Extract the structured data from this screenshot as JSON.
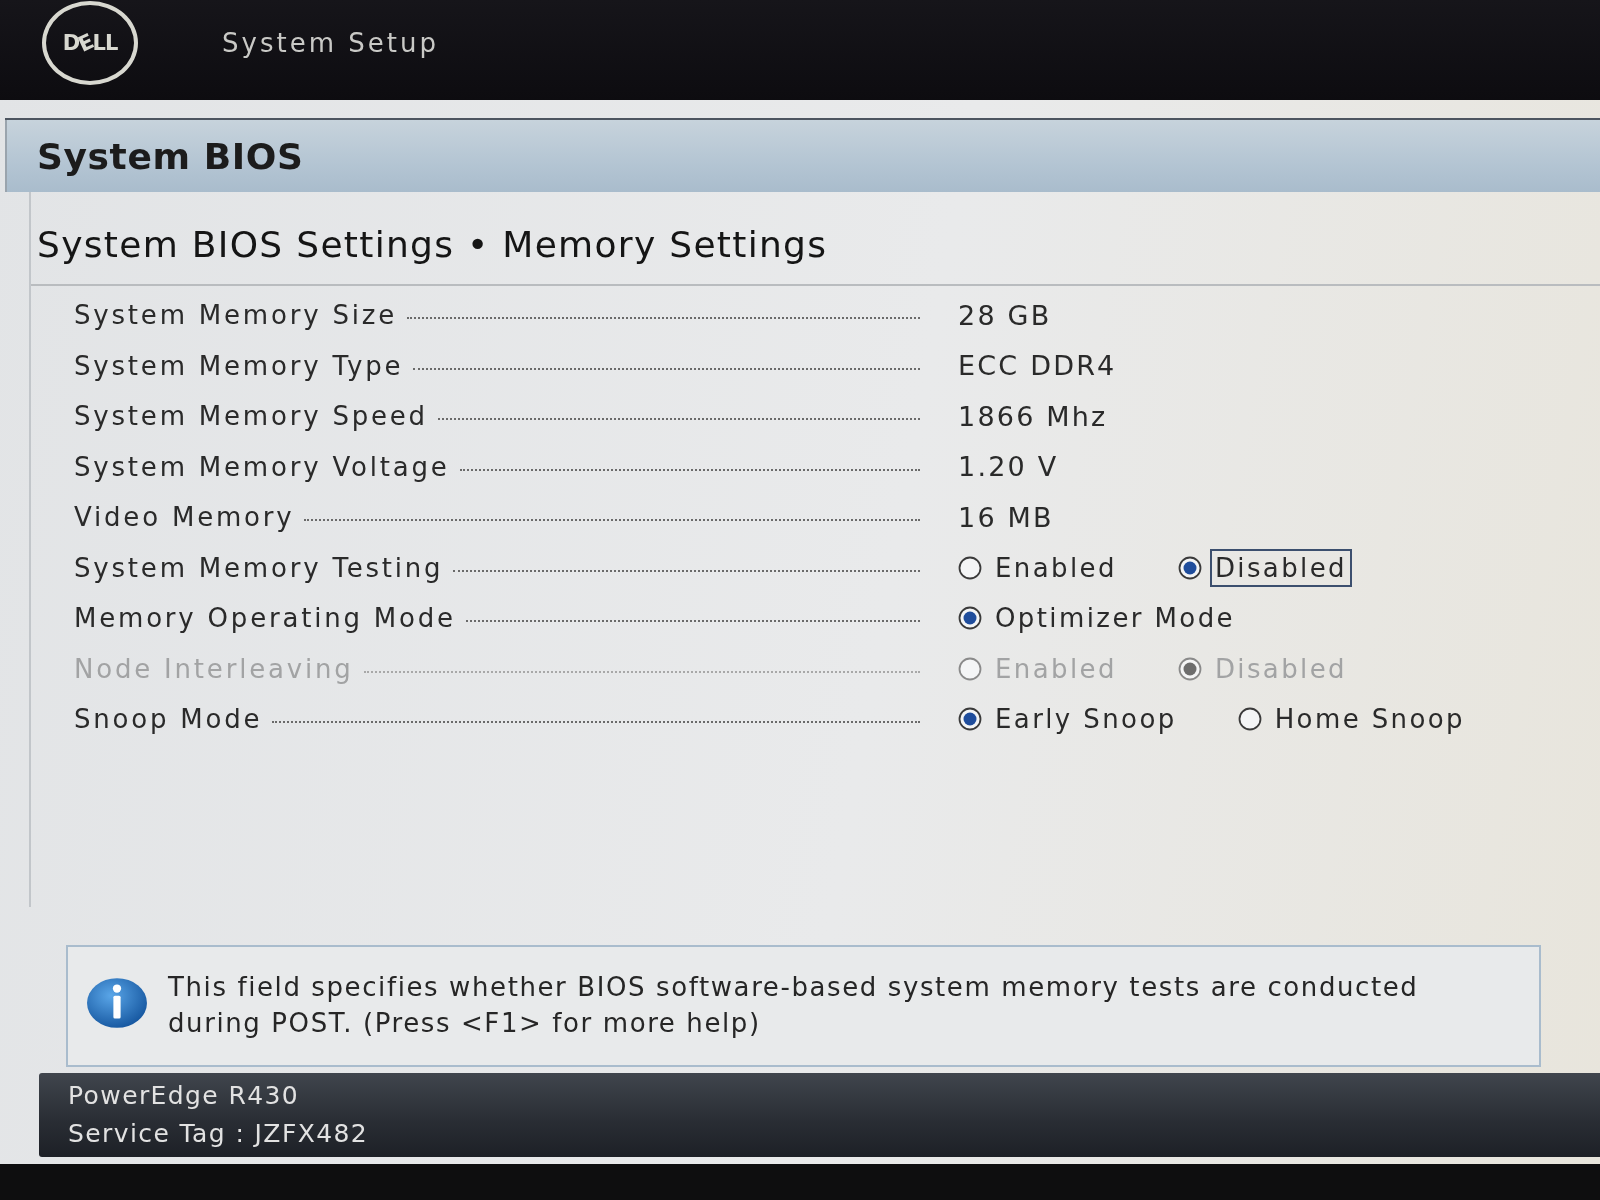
{
  "header": {
    "logo": "DELL",
    "title": "System Setup"
  },
  "page": {
    "title": "System BIOS",
    "subtitle": "System BIOS Settings • Memory Settings"
  },
  "settings": [
    {
      "kind": "text",
      "label": "System Memory Size",
      "value": "28 GB",
      "disabled": false
    },
    {
      "kind": "text",
      "label": "System Memory Type",
      "value": "ECC DDR4",
      "disabled": false
    },
    {
      "kind": "text",
      "label": "System Memory Speed",
      "value": "1866 Mhz",
      "disabled": false
    },
    {
      "kind": "text",
      "label": "System Memory Voltage",
      "value": "1.20 V",
      "disabled": false
    },
    {
      "kind": "text",
      "label": "Video Memory",
      "value": "16 MB",
      "disabled": false
    },
    {
      "kind": "radio",
      "label": "System Memory Testing",
      "disabled": false,
      "options": [
        {
          "label": "Enabled",
          "selected": false,
          "focused": false
        },
        {
          "label": "Disabled",
          "selected": true,
          "focused": true
        }
      ]
    },
    {
      "kind": "radio",
      "label": "Memory Operating Mode",
      "disabled": false,
      "options": [
        {
          "label": "Optimizer Mode",
          "selected": true,
          "focused": false
        }
      ]
    },
    {
      "kind": "radio",
      "label": "Node Interleaving",
      "disabled": true,
      "options": [
        {
          "label": "Enabled",
          "selected": false,
          "focused": false
        },
        {
          "label": "Disabled",
          "selected": true,
          "focused": false
        }
      ]
    },
    {
      "kind": "radio",
      "label": "Snoop Mode",
      "disabled": false,
      "options": [
        {
          "label": "Early Snoop",
          "selected": true,
          "focused": false
        },
        {
          "label": "Home Snoop",
          "selected": false,
          "focused": false
        }
      ]
    }
  ],
  "help": {
    "text": "This field specifies whether BIOS software-based system memory tests are conducted during POST. (Press <F1> for more help)"
  },
  "footer": {
    "model": "PowerEdge R430",
    "service_tag": "Service Tag : JZFX482"
  }
}
